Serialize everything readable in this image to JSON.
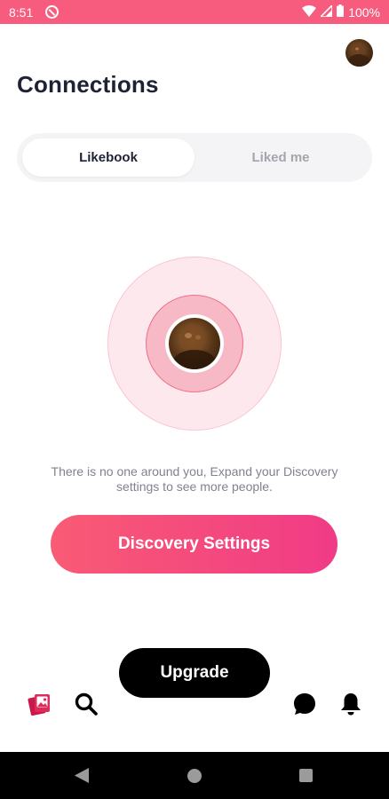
{
  "status_bar": {
    "time": "8:51",
    "battery": "100%",
    "background_color": "#f75c7e"
  },
  "header": {
    "title": "Connections"
  },
  "tabs": [
    {
      "label": "Likebook",
      "active": true
    },
    {
      "label": "Liked me",
      "active": false
    }
  ],
  "empty_state": {
    "message": "There is no one around you, Expand your Discovery settings to see more people."
  },
  "buttons": {
    "discovery_settings": "Discovery Settings",
    "upgrade": "Upgrade"
  },
  "bottom_nav": {
    "items": [
      "cards-icon",
      "search-icon",
      "chat-icon",
      "bell-icon"
    ]
  },
  "colors": {
    "accent_start": "#f95b74",
    "accent_end": "#f03b86",
    "title": "#1f2235",
    "muted_text": "#808290"
  }
}
